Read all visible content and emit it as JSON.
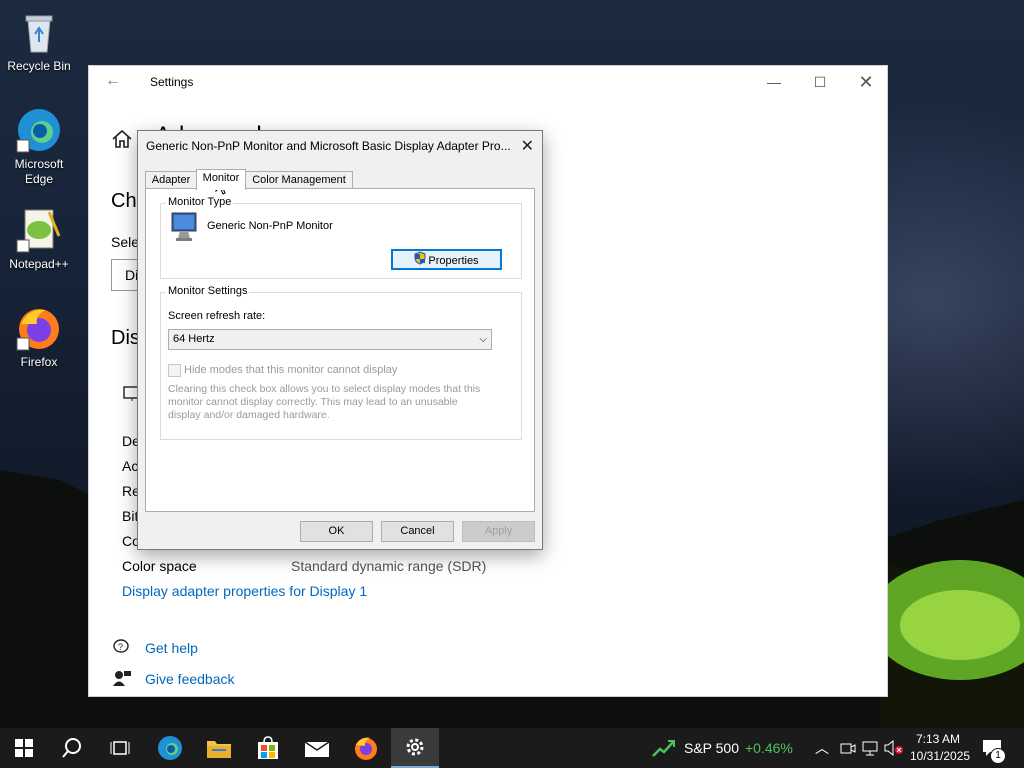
{
  "desktop": {
    "icons": [
      {
        "label": "Recycle Bin",
        "icon": "recycle-bin-icon"
      },
      {
        "label": "Microsoft Edge",
        "icon": "edge-icon"
      },
      {
        "label": "Notepad++",
        "icon": "notepadpp-icon"
      },
      {
        "label": "Firefox",
        "icon": "firefox-icon"
      }
    ]
  },
  "settings": {
    "window_title": "Settings",
    "page_title": "Advanced display settings",
    "section1_heading": "Cho",
    "select_label": "Sele",
    "dropdown_partial": "Di",
    "section2_heading": "Dis",
    "info_labels": [
      "De",
      "Ac",
      "Re",
      "Bit",
      "Co"
    ],
    "color_space_label": "Color space",
    "color_space_value": "Standard dynamic range (SDR)",
    "adapter_link": "Display adapter properties for Display 1",
    "help_link": "Get help",
    "feedback_link": "Give feedback"
  },
  "dialog": {
    "title": "Generic Non-PnP Monitor and Microsoft Basic Display Adapter Pro...",
    "tabs": [
      "Adapter",
      "Monitor",
      "Color Management"
    ],
    "active_tab": "Monitor",
    "monitor_type_group": "Monitor Type",
    "monitor_name": "Generic Non-PnP Monitor",
    "properties_button": "Properties",
    "monitor_settings_group": "Monitor Settings",
    "refresh_label": "Screen refresh rate:",
    "refresh_value": "64 Hertz",
    "hide_modes_label": "Hide modes that this monitor cannot display",
    "hide_modes_checked": false,
    "hide_modes_desc_line1": "Clearing this check box allows you to select display modes that this",
    "hide_modes_desc_line2": "monitor cannot display correctly. This may lead to an unusable",
    "hide_modes_desc_line3": "display and/or damaged hardware.",
    "ok_button": "OK",
    "cancel_button": "Cancel",
    "apply_button": "Apply"
  },
  "taskbar": {
    "apps": [
      "start-icon",
      "search-icon",
      "task-view-icon",
      "edge-icon",
      "file-explorer-icon",
      "store-icon",
      "mail-icon",
      "firefox-icon",
      "settings-icon"
    ],
    "stock_name": "S&P 500",
    "stock_change": "+0.46%",
    "time": "7:13 AM",
    "date": "10/31/2025",
    "notification_count": "1"
  },
  "colors": {
    "accent": "#0078d7",
    "link": "#0067c0",
    "stock_green": "#4cc25a"
  }
}
